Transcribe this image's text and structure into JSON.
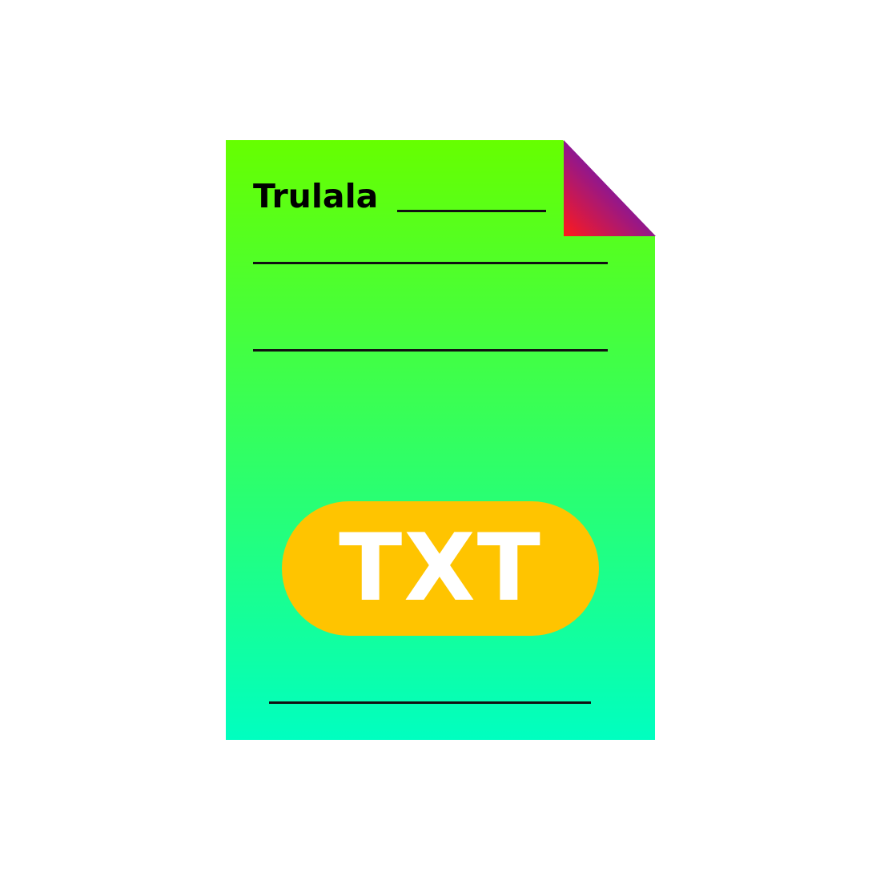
{
  "document": {
    "title": "Trulala",
    "badge_label": "TXT"
  },
  "colors": {
    "page_gradient_top": "#66ff00",
    "page_gradient_bottom": "#00ffc0",
    "fold_gradient_start": "#ff1a1a",
    "fold_gradient_end": "#7a16a6",
    "badge": "#ffc400",
    "badge_text": "#ffffff",
    "lines": "#111111"
  },
  "icons": {
    "main": "txt-file-icon",
    "corner": "page-fold-corner"
  }
}
